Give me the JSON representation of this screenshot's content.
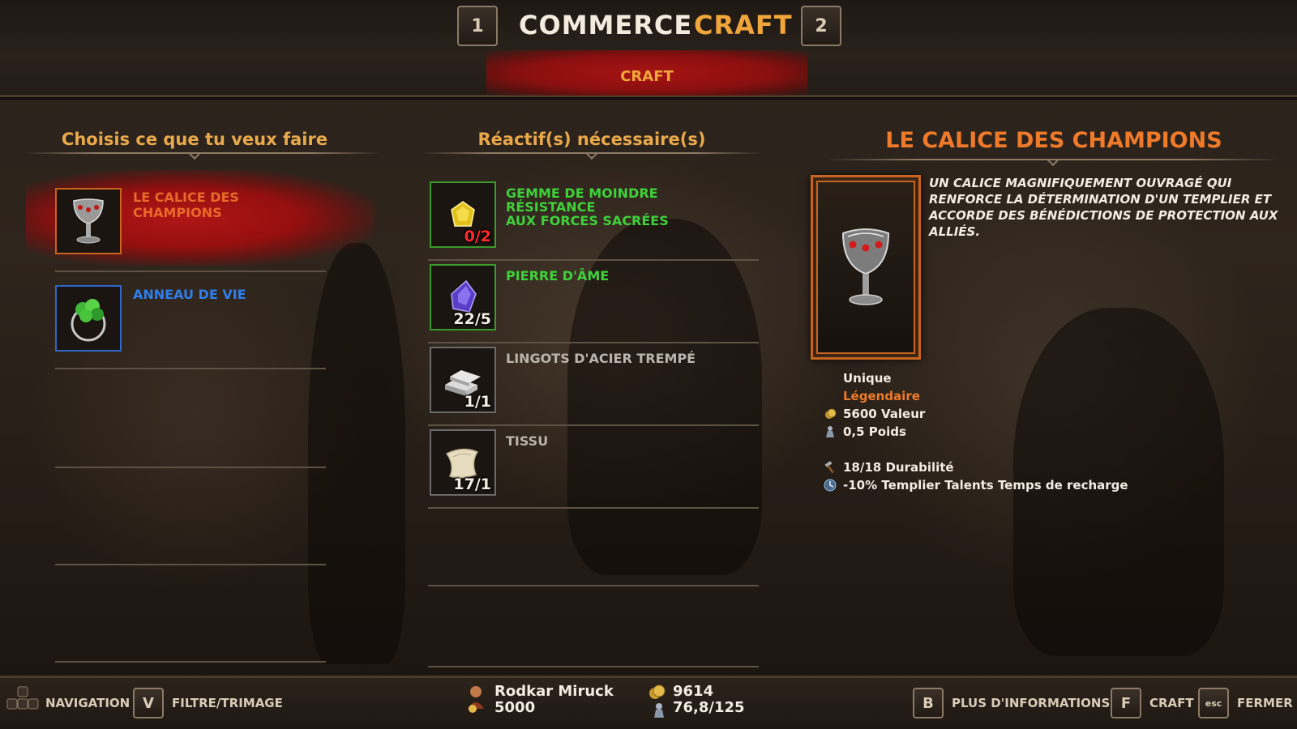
{
  "header": {
    "tab_prev_key": "1",
    "tab_next_key": "2",
    "tabs": [
      {
        "label": "COMMERCE",
        "active": false
      },
      {
        "label": "CRAFT",
        "active": true
      }
    ],
    "subtab": "CRAFT"
  },
  "recipes": {
    "heading": "Choisis ce que tu veux faire",
    "items": [
      {
        "name": "LE CALICE DES CHAMPIONS",
        "icon": "chalice-icon",
        "rarity_color": "#e9692a",
        "selected": true
      },
      {
        "name": "ANNEAU DE VIE",
        "icon": "ring-icon",
        "rarity_color": "#2f7de8",
        "selected": false
      }
    ]
  },
  "reagents": {
    "heading": "Réactif(s) nécessaire(s)",
    "items": [
      {
        "name_line1": "GEMME DE MOINDRE RÉSISTANCE",
        "name_line2": "AUX FORCES SACRÉES",
        "count": "0/2",
        "icon": "gem-icon",
        "name_color": "#3fd13a",
        "count_color": "#ff2a2a"
      },
      {
        "name_line1": "PIERRE D'ÂME",
        "name_line2": "",
        "count": "22/5",
        "icon": "soul-stone-icon",
        "name_color": "#3fd13a",
        "count_color": "#f2ece2"
      },
      {
        "name_line1": "LINGOTS D'ACIER TREMPÉ",
        "name_line2": "",
        "count": "1/1",
        "icon": "steel-ingot-icon",
        "name_color": "#b9b4ac",
        "count_color": "#f2ece2"
      },
      {
        "name_line1": "TISSU",
        "name_line2": "",
        "count": "17/1",
        "icon": "cloth-icon",
        "name_color": "#b9b4ac",
        "count_color": "#f2ece2"
      }
    ]
  },
  "detail": {
    "title": "LE CALICE DES CHAMPIONS",
    "description": "UN CALICE MAGNIFIQUEMENT OUVRAGÉ QUI RENFORCE LA DÉTERMINATION D'UN TEMPLIER ET ACCORDE DES BÉNÉDICTIONS DE PROTECTION AUX ALLIÉS.",
    "type": "Unique",
    "rarity": "Légendaire",
    "value": "5600 Valeur",
    "weight": "0,5 Poids",
    "durability": "18/18 Durabilité",
    "bonus": "-10% Templier Talents Temps de recharge",
    "colors": {
      "rarity": "#ee7a2a",
      "frame": "#c9641e"
    }
  },
  "footer": {
    "nav_label": "NAVIGATION",
    "filter_key": "V",
    "filter_label": "FILTRE/TRIMAGE",
    "player_name": "Rodkar Miruck",
    "player_gold": "5000",
    "shop_gold": "9614",
    "shop_weight": "76,8/125",
    "info_key": "B",
    "info_label": "PLUS D'INFORMATIONS",
    "craft_key": "F",
    "craft_label": "CRAFT",
    "close_key": "esc",
    "close_label": "FERMER"
  }
}
